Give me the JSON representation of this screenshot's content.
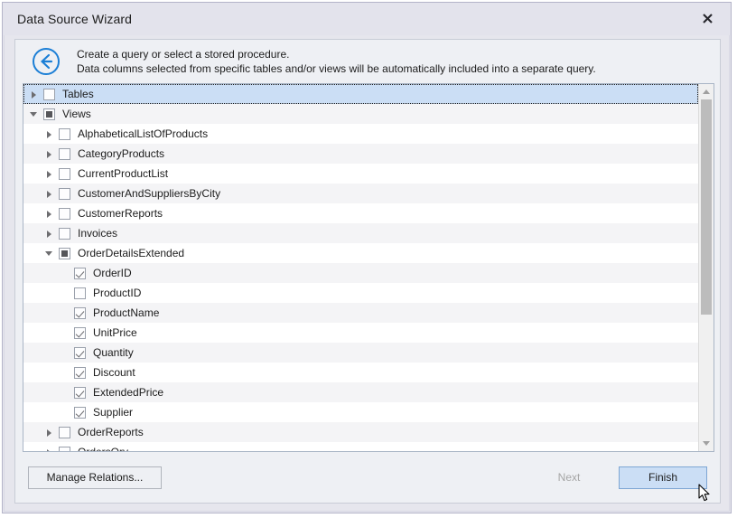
{
  "window": {
    "title": "Data Source Wizard",
    "close_label": "✕"
  },
  "header": {
    "back_icon": "back-circle-arrow-icon",
    "line1": "Create a query or select a stored procedure.",
    "line2": "Data columns selected from specific tables and/or views will be automatically included into a separate query."
  },
  "tree": {
    "rows": [
      {
        "label": "Tables",
        "level": 0,
        "expander": "collapsed",
        "check": "unchecked",
        "selected": true
      },
      {
        "label": "Views",
        "level": 0,
        "expander": "expanded",
        "check": "partial",
        "selected": false
      },
      {
        "label": "AlphabeticalListOfProducts",
        "level": 1,
        "expander": "collapsed",
        "check": "unchecked",
        "selected": false
      },
      {
        "label": "CategoryProducts",
        "level": 1,
        "expander": "collapsed",
        "check": "unchecked",
        "selected": false
      },
      {
        "label": "CurrentProductList",
        "level": 1,
        "expander": "collapsed",
        "check": "unchecked",
        "selected": false
      },
      {
        "label": "CustomerAndSuppliersByCity",
        "level": 1,
        "expander": "collapsed",
        "check": "unchecked",
        "selected": false
      },
      {
        "label": "CustomerReports",
        "level": 1,
        "expander": "collapsed",
        "check": "unchecked",
        "selected": false
      },
      {
        "label": "Invoices",
        "level": 1,
        "expander": "collapsed",
        "check": "unchecked",
        "selected": false
      },
      {
        "label": "OrderDetailsExtended",
        "level": 1,
        "expander": "expanded",
        "check": "partial",
        "selected": false
      },
      {
        "label": "OrderID",
        "level": 2,
        "expander": "none",
        "check": "checked",
        "selected": false
      },
      {
        "label": "ProductID",
        "level": 2,
        "expander": "none",
        "check": "unchecked",
        "selected": false
      },
      {
        "label": "ProductName",
        "level": 2,
        "expander": "none",
        "check": "checked",
        "selected": false
      },
      {
        "label": "UnitPrice",
        "level": 2,
        "expander": "none",
        "check": "checked",
        "selected": false
      },
      {
        "label": "Quantity",
        "level": 2,
        "expander": "none",
        "check": "checked",
        "selected": false
      },
      {
        "label": "Discount",
        "level": 2,
        "expander": "none",
        "check": "checked",
        "selected": false
      },
      {
        "label": "ExtendedPrice",
        "level": 2,
        "expander": "none",
        "check": "checked",
        "selected": false
      },
      {
        "label": "Supplier",
        "level": 2,
        "expander": "none",
        "check": "checked",
        "selected": false
      },
      {
        "label": "OrderReports",
        "level": 1,
        "expander": "collapsed",
        "check": "unchecked",
        "selected": false
      },
      {
        "label": "OrdersQry",
        "level": 1,
        "expander": "collapsed",
        "check": "unchecked",
        "selected": false
      }
    ],
    "scrollbar": {
      "up_arrow": "triangle-up-icon",
      "down_arrow": "triangle-down-icon",
      "thumb_fraction": 0.64
    }
  },
  "footer": {
    "manage_relations_label": "Manage Relations...",
    "next_label": "Next",
    "finish_label": "Finish"
  },
  "colors": {
    "accent": "#1c7fd6",
    "selection": "#cbdef5",
    "window_chrome": "#e3e3ec",
    "panel": "#eef0f4"
  }
}
